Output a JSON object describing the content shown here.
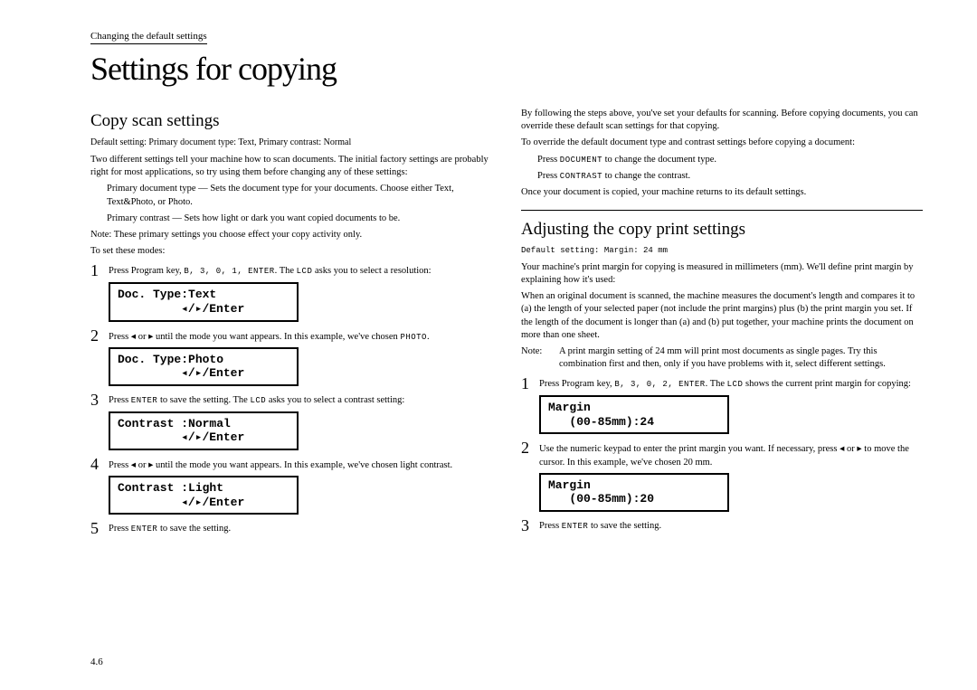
{
  "header": "Changing the default settings",
  "main_title": "Settings for copying",
  "page_num": "4.6",
  "left": {
    "section_title": "Copy scan settings",
    "default_line": "Default setting: Primary document type: Text, Primary contrast: Normal",
    "intro": "Two different settings tell your machine how to scan documents. The initial factory settings are probably right for most applications, so try using them before changing any of these settings:",
    "def1_label": "Primary document type —",
    "def1_body": "Sets the document type for your documents. Choose either Text, Text&Photo, or Photo.",
    "def2_label": "Primary contrast —",
    "def2_body": "Sets how light or dark you want copied documents to be.",
    "note_label": "Note:",
    "note_body": "These primary settings you choose effect your copy activity only.",
    "to_set": "To set these modes:",
    "step1_pre": "Press Program key,",
    "step1_keys": "B, 3, 0, 1, ENTER",
    "step1_post": ". The ",
    "step1_lcd_word": "LCD",
    "step1_tail": " asks you to select a resolution:",
    "lcd1_l1": "Doc. Type:Text",
    "lcd1_l2": "◂/▸/Enter",
    "step2_pre": "Press ",
    "step2_arrows1": "◂",
    "step2_or": " or ",
    "step2_arrows2": "▸",
    "step2_post": " until the mode you want appears. In this example, we've chosen ",
    "step2_choice": "PHOTO",
    "step2_end": ".",
    "lcd2_l1": "Doc. Type:Photo",
    "lcd2_l2": "◂/▸/Enter",
    "step3_pre": "Press ",
    "step3_key": "ENTER",
    "step3_mid": " to save the setting. The ",
    "step3_lcd_word": "LCD",
    "step3_tail": " asks you to select a contrast setting:",
    "lcd3_l1": "Contrast  :Normal",
    "lcd3_l2": "◂/▸/Enter",
    "step4_pre": "Press ",
    "step4_a1": "◂",
    "step4_or": " or ",
    "step4_a2": "▸",
    "step4_post": " until the mode you want appears. In this example, we've chosen light contrast.",
    "lcd4_l1": "Contrast  :Light",
    "lcd4_l2": "◂/▸/Enter",
    "step5_pre": "Press ",
    "step5_key": "ENTER",
    "step5_post": " to save the setting."
  },
  "right": {
    "para1": "By following the steps above, you've set your defaults for scanning. Before copying documents, you can override these default scan settings for that copying.",
    "para2": "To override the default document type and contrast settings before copying a document:",
    "bullet1_pre": "Press ",
    "bullet1_key": "DOCUMENT",
    "bullet1_post": " to change the document type.",
    "bullet2_pre": "Press ",
    "bullet2_key": "CONTRAST",
    "bullet2_post": " to change the contrast.",
    "para3": "Once your document is copied, your machine returns to its default settings.",
    "section_title": "Adjusting the copy print settings",
    "default_line": "Default setting:  Margin: 24 mm",
    "intro": "Your machine's print margin for copying is measured in millimeters (mm). We'll define print margin by explaining how it's used:",
    "body1": "When an original document is scanned, the machine measures the document's length and compares it to (a) the length of your selected paper (not include the print margins) plus (b) the print margin you set. If the length of the document is longer than (a) and (b) put together, your machine prints the document on more than one sheet.",
    "note_label": "Note:",
    "note_body": "A print margin setting of 24 mm will print most documents as single pages. Try this combination first and then, only if you have problems with it, select different settings.",
    "step1_pre": "Press Program key,",
    "step1_keys": "B, 3, 0, 2, ENTER",
    "step1_post": ". The ",
    "step1_lcd_word": "LCD",
    "step1_tail": " shows the current print margin for copying:",
    "lcd1_l1": "Margin",
    "lcd1_l2": "   (00-85mm):24",
    "step2_pre": "Use the numeric keypad to enter the print margin you want. If necessary, press ",
    "step2_a1": "◂",
    "step2_or": " or ",
    "step2_a2": "▸",
    "step2_post": " to move the cursor. In this example, we've chosen 20 mm.",
    "lcd2_l1": "Margin",
    "lcd2_l2": "   (00-85mm):20",
    "step3_pre": "Press ",
    "step3_key": "ENTER",
    "step3_post": " to save the setting."
  }
}
